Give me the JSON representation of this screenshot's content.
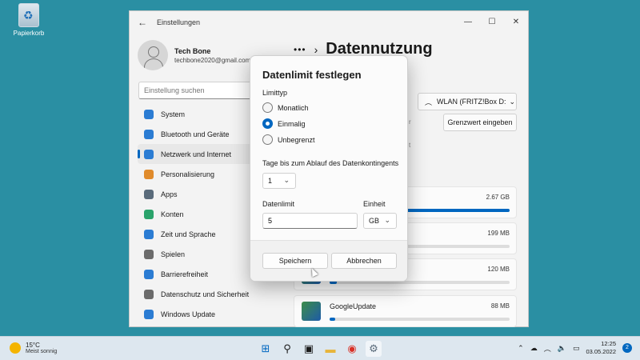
{
  "desktop": {
    "recycle_bin_label": "Papierkorb"
  },
  "window": {
    "title": "Einstellungen",
    "profile": {
      "name": "Tech Bone",
      "email": "techbone2020@gmail.com"
    },
    "search_placeholder": "Einstellung suchen",
    "nav": [
      {
        "label": "System",
        "icon": "monitor-icon",
        "color": "#2b7cd3"
      },
      {
        "label": "Bluetooth und Geräte",
        "icon": "bluetooth-icon",
        "color": "#2b7cd3"
      },
      {
        "label": "Netzwerk und Internet",
        "icon": "wifi-icon",
        "color": "#2b7cd3"
      },
      {
        "label": "Personalisierung",
        "icon": "brush-icon",
        "color": "#e08b2c"
      },
      {
        "label": "Apps",
        "icon": "apps-icon",
        "color": "#5a6b7b"
      },
      {
        "label": "Konten",
        "icon": "person-icon",
        "color": "#2aa36b"
      },
      {
        "label": "Zeit und Sprache",
        "icon": "globe-icon",
        "color": "#2b7cd3"
      },
      {
        "label": "Spielen",
        "icon": "gamepad-icon",
        "color": "#6b6b6b"
      },
      {
        "label": "Barrierefreiheit",
        "icon": "accessibility-icon",
        "color": "#2b7cd3"
      },
      {
        "label": "Datenschutz und Sicherheit",
        "icon": "shield-icon",
        "color": "#6b6b6b"
      },
      {
        "label": "Windows Update",
        "icon": "update-icon",
        "color": "#2b7cd3"
      }
    ],
    "active_nav_index": 2,
    "page_title": "Datennutzung",
    "network_select": "WLAN (FRITZ!Box D:",
    "limit_button": "Grenzwert eingeben",
    "apps": [
      {
        "name": "",
        "size": "2.67 GB",
        "fill": 1.0
      },
      {
        "name": "",
        "size": "199 MB",
        "fill": 0.07
      },
      {
        "name": "",
        "size": "120 MB",
        "fill": 0.04
      },
      {
        "name": "GoogleUpdate",
        "size": "88 MB",
        "fill": 0.03
      }
    ]
  },
  "dialog": {
    "title": "Datenlimit festlegen",
    "limit_type_label": "Limittyp",
    "options": [
      "Monatlich",
      "Einmalig",
      "Unbegrenzt"
    ],
    "selected_option": 1,
    "days_label": "Tage bis zum Ablauf des Datenkontingents",
    "days_value": "1",
    "data_limit_label": "Datenlimit",
    "data_limit_value": "5",
    "unit_label": "Einheit",
    "unit_value": "GB",
    "save": "Speichern",
    "cancel": "Abbrechen"
  },
  "taskbar": {
    "weather_temp": "15°C",
    "weather_text": "Meist sonnig",
    "time": "12:25",
    "date": "03.05.2022",
    "notifications": "2"
  }
}
